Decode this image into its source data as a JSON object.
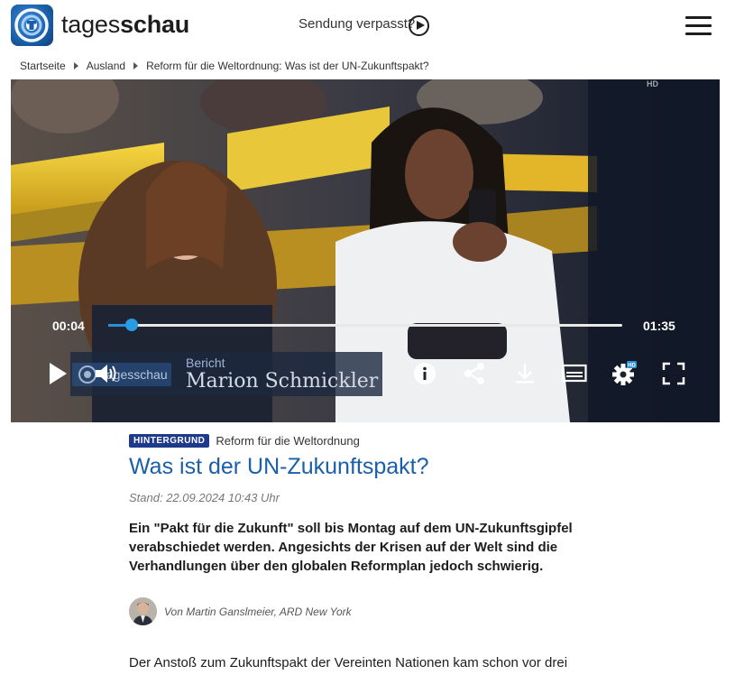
{
  "header": {
    "brand_regular": "tages",
    "brand_bold": "schau",
    "missed_show_label": "Sendung verpasst?"
  },
  "breadcrumb": {
    "items": [
      "Startseite",
      "Ausland",
      "Reform für die Weltordnung: Was ist der UN-Zukunftspakt?"
    ]
  },
  "video": {
    "hd_label": "HD",
    "current_time": "00:04",
    "total_time": "01:35",
    "progress": 0.045,
    "banner_logo": "tagesschau",
    "banner_kicker": "Bericht",
    "banner_name": "Marion Schmickler",
    "settings_badge": "HD",
    "accent_color": "#2a9be0"
  },
  "article": {
    "badge": "HINTERGRUND",
    "kicker": "Reform für die Weltordnung",
    "headline": "Was ist der UN-Zukunftspakt?",
    "dateline": "Stand: 22.09.2024 10:43 Uhr",
    "teaser": "Ein \"Pakt für die Zukunft\" soll bis Montag auf dem UN-Zukunftsgipfel verabschiedet werden. Angesichts der Krisen auf der Welt sind die Verhandlungen über den globalen Reformplan jedoch schwierig.",
    "author": "Von Martin Ganslmeier, ARD New York",
    "body_start": "Der Anstoß zum Zukunftspakt der Vereinten Nationen kam schon vor drei",
    "headline_color": "#1b5fa8",
    "badge_color": "#1f3a8a"
  }
}
